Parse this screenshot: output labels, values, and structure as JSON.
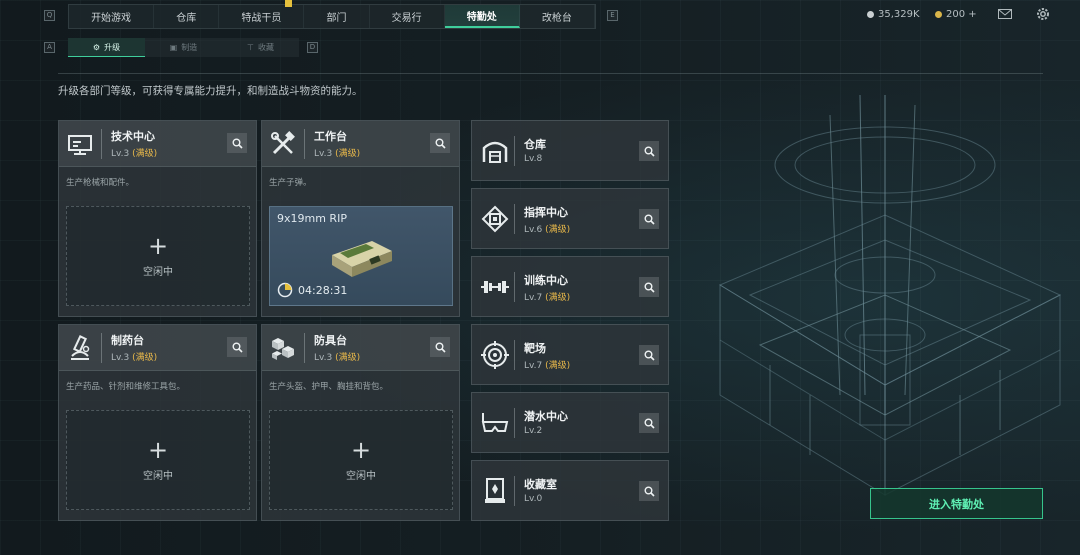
{
  "top_nav": {
    "left_key": "Q",
    "right_key": "E",
    "tabs": [
      "开始游戏",
      "仓库",
      "特战干员",
      "部门",
      "交易行",
      "特勤处",
      "改枪台"
    ],
    "active_tab": "特勤处"
  },
  "currency": {
    "silver": "35,329K",
    "gold": "200 +"
  },
  "sub_nav": {
    "left_key": "A",
    "right_key": "D",
    "tabs": [
      {
        "label": "升级",
        "icon": "upgrade-icon",
        "active": true
      },
      {
        "label": "制造",
        "icon": "craft-icon",
        "active": false
      },
      {
        "label": "收藏",
        "icon": "collection-icon",
        "active": false
      }
    ]
  },
  "intro": "升级各部门等级，可获得专属能力提升，和制造战斗物资的能力。",
  "cards": [
    {
      "title": "技术中心",
      "level": "Lv.3",
      "max": "(满级)",
      "desc": "生产枪械和配件。",
      "icon": "tech-center-icon",
      "status": "空闲中"
    },
    {
      "title": "工作台",
      "level": "Lv.3",
      "max": "(满级)",
      "desc": "生产子弹。",
      "icon": "workbench-icon",
      "crafting": {
        "item": "9x19mm RIP",
        "time": "04:28:31"
      }
    },
    {
      "title": "制药台",
      "level": "Lv.3",
      "max": "(满级)",
      "desc": "生产药品、针剂和维修工具包。",
      "icon": "pharmacy-icon",
      "status": "空闲中"
    },
    {
      "title": "防具台",
      "level": "Lv.3",
      "max": "(满级)",
      "desc": "生产头盔、护甲、胸挂和背包。",
      "icon": "armor-bench-icon",
      "status": "空闲中"
    }
  ],
  "departments": [
    {
      "title": "仓库",
      "level": "Lv.8",
      "max": "",
      "icon": "warehouse-icon"
    },
    {
      "title": "指挥中心",
      "level": "Lv.6",
      "max": "(满级)",
      "icon": "command-center-icon"
    },
    {
      "title": "训练中心",
      "level": "Lv.7",
      "max": "(满级)",
      "icon": "training-center-icon"
    },
    {
      "title": "靶场",
      "level": "Lv.7",
      "max": "(满级)",
      "icon": "shooting-range-icon"
    },
    {
      "title": "潜水中心",
      "level": "Lv.2",
      "max": "",
      "icon": "diving-center-icon"
    },
    {
      "title": "收藏室",
      "level": "Lv.0",
      "max": "",
      "icon": "collection-room-icon"
    }
  ],
  "enter_button": "进入特勤处",
  "colors": {
    "accent": "#3fcf9c",
    "max_level": "#e8b84a",
    "notification": "#e6c13d"
  }
}
